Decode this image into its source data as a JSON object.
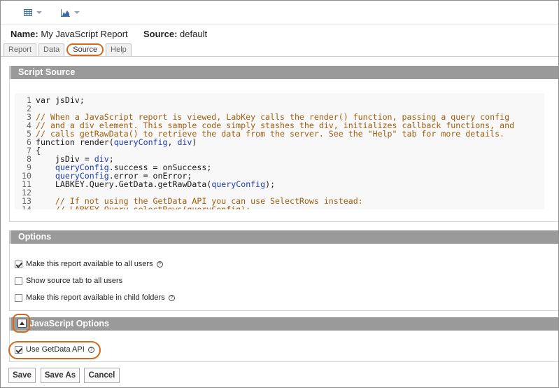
{
  "toolbar": {
    "grid_icon": "grid-view-icon",
    "chart_icon": "chart-icon"
  },
  "report": {
    "name_label": "Name:",
    "name_value": "My JavaScript Report",
    "source_label": "Source:",
    "source_value": "default"
  },
  "tabs": [
    {
      "label": "Report",
      "active": false
    },
    {
      "label": "Data",
      "active": false
    },
    {
      "label": "Source",
      "active": true
    },
    {
      "label": "Help",
      "active": false
    }
  ],
  "script_source": {
    "title": "Script Source",
    "line_numbers": [
      "1",
      "2",
      "3",
      "4",
      "5",
      "6",
      "7",
      "8",
      "9",
      "10",
      "11",
      "12",
      "13",
      "14"
    ],
    "lines": [
      "var jsDiv;",
      "",
      "// When a JavaScript report is viewed, LabKey calls the render() function, passing a query config",
      "// and a div element. This sample code simply stashes the div, initializes callback functions, and",
      "// calls getRawData() to retrieve the data from the server. See the \"Help\" tab for more details.",
      "function render(queryConfig, div)",
      "{",
      "    jsDiv = div;",
      "    queryConfig.success = onSuccess;",
      "    queryConfig.error = onError;",
      "    LABKEY.Query.GetData.getRawData(queryConfig);",
      "",
      "    // If not using the GetData API you can use SelectRows instead:",
      "    // LABKEY.Query.selectRows(queryConfig);"
    ]
  },
  "options": {
    "title": "Options",
    "items": [
      {
        "label": "Make this report available to all users",
        "checked": true,
        "help": "?"
      },
      {
        "label": "Show source tab to all users",
        "checked": false
      },
      {
        "label": "Make this report available in child folders",
        "checked": false,
        "help": "?"
      }
    ]
  },
  "js_options": {
    "title": "JavaScript Options",
    "getdata_label": "Use GetData API",
    "getdata_checked": true,
    "help": "?"
  },
  "buttons": {
    "save": "Save",
    "save_as": "Save As",
    "cancel": "Cancel"
  },
  "colors": {
    "highlight": "#d2691e",
    "panel_header": "#9a9a9a",
    "comment": "#a15d0c",
    "identifier": "#1a3bb4"
  }
}
